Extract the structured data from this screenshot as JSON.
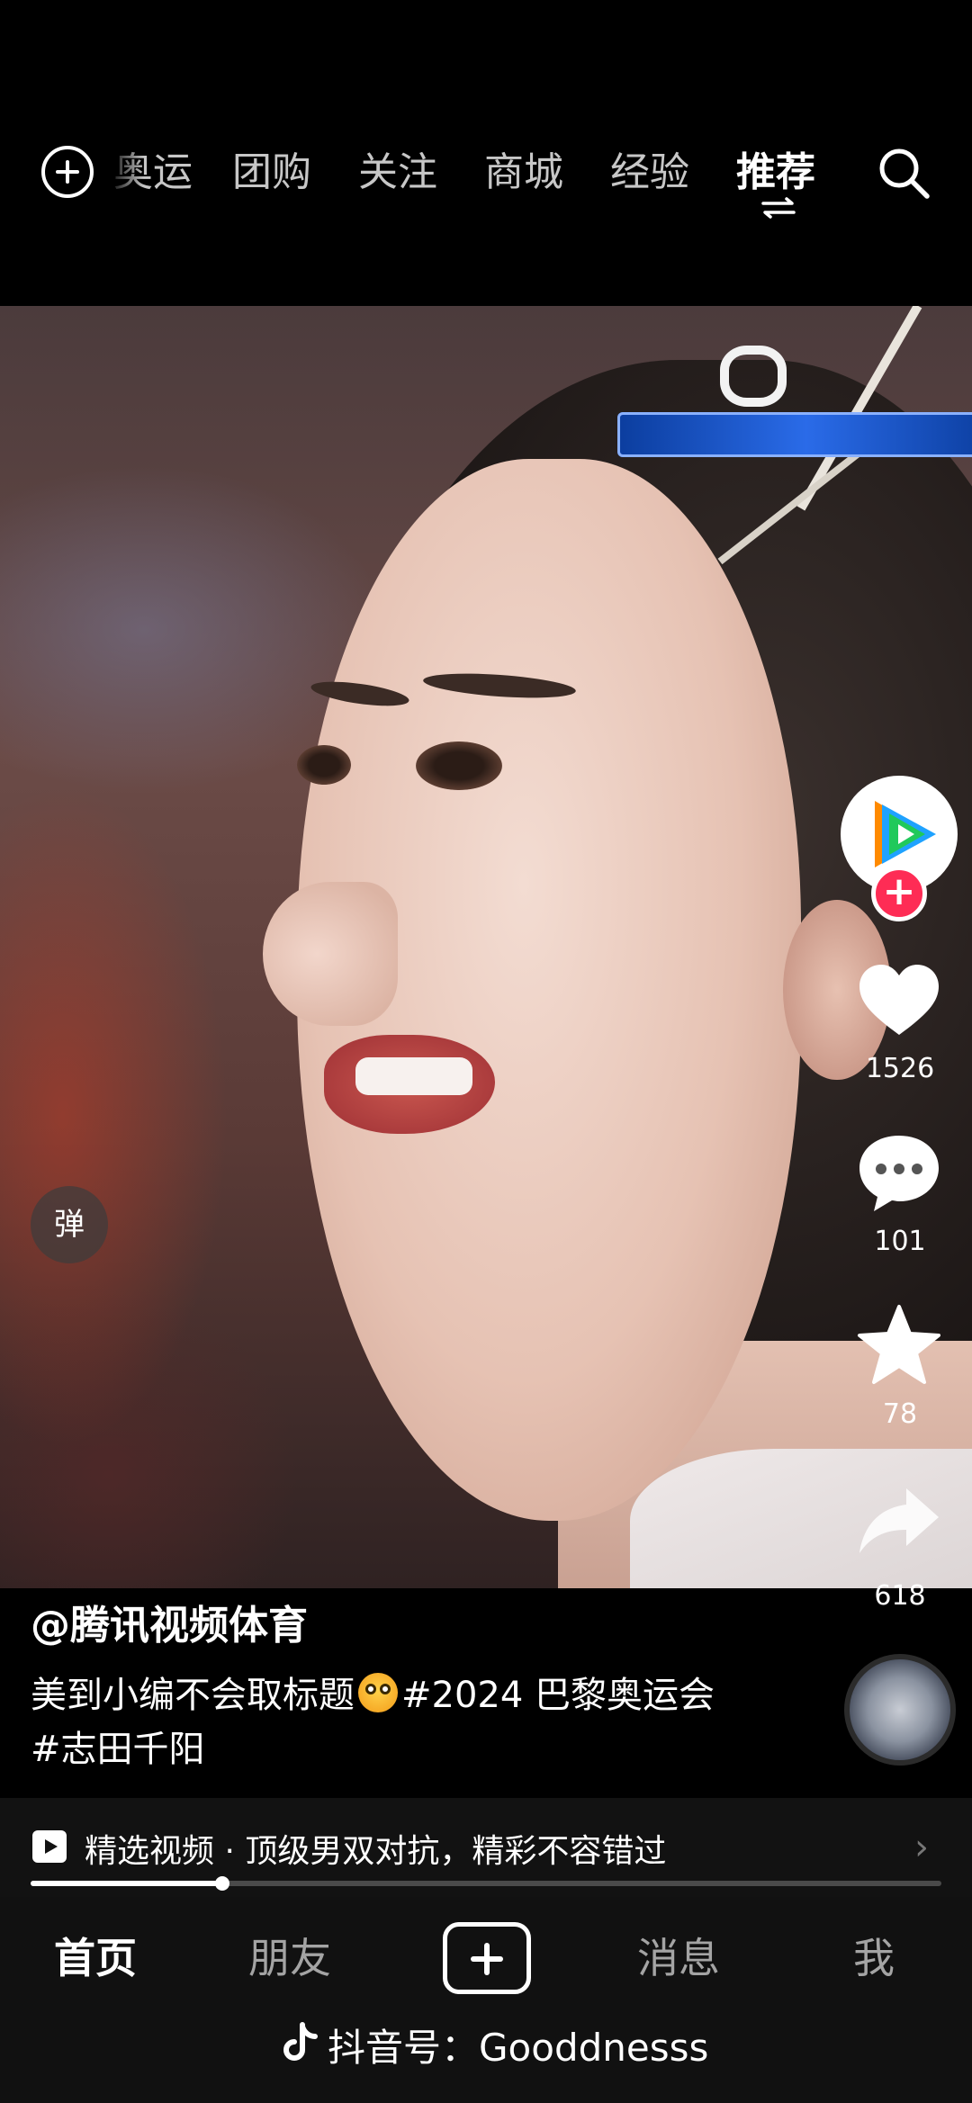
{
  "top_nav": {
    "tabs": [
      {
        "label": "奥运",
        "active": false
      },
      {
        "label": "团购",
        "active": false
      },
      {
        "label": "关注",
        "active": false
      },
      {
        "label": "商城",
        "active": false
      },
      {
        "label": "经验",
        "active": false
      },
      {
        "label": "推荐",
        "active": true
      }
    ],
    "left_icon": "add-circle-icon",
    "right_icon": "search-icon"
  },
  "video": {
    "danmu_label": "弹"
  },
  "actions": {
    "like_count": "1526",
    "comment_count": "101",
    "favorite_count": "78",
    "share_count": "618",
    "accent_color": "#fe2c55"
  },
  "post": {
    "author": "@腾讯视频体育",
    "description_line1": "美到小编不会取标题",
    "emoji": "flushed-face-emoji",
    "description_hashtag1": "#2024 巴黎奥运会",
    "description_line2": "#志田千阳"
  },
  "recommendation": {
    "text": "精选视频 · 顶级男双对抗，精彩不容错过",
    "progress": 0.21
  },
  "bottom_nav": {
    "home": "首页",
    "friends": "朋友",
    "messages": "消息",
    "me": "我"
  },
  "watermark": {
    "text": "抖音号：Gooddnesss"
  }
}
